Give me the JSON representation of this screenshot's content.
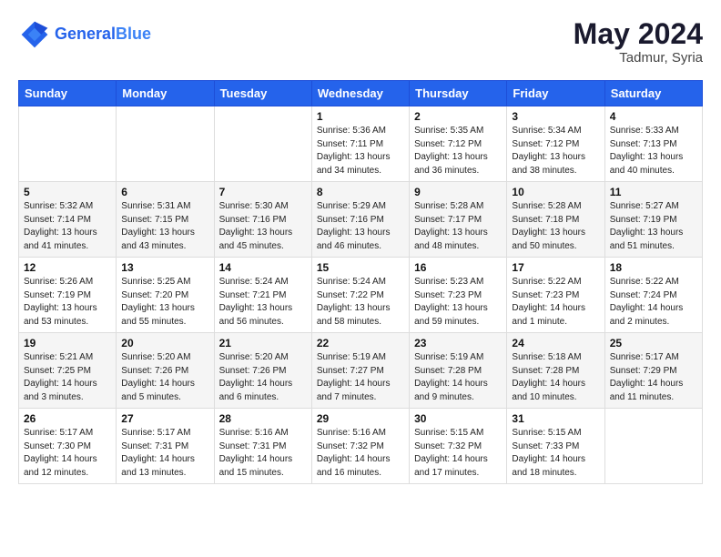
{
  "header": {
    "logo_line1": "General",
    "logo_line2": "Blue",
    "month_year": "May 2024",
    "location": "Tadmur, Syria"
  },
  "weekdays": [
    "Sunday",
    "Monday",
    "Tuesday",
    "Wednesday",
    "Thursday",
    "Friday",
    "Saturday"
  ],
  "weeks": [
    [
      {
        "day": "",
        "info": ""
      },
      {
        "day": "",
        "info": ""
      },
      {
        "day": "",
        "info": ""
      },
      {
        "day": "1",
        "info": "Sunrise: 5:36 AM\nSunset: 7:11 PM\nDaylight: 13 hours\nand 34 minutes."
      },
      {
        "day": "2",
        "info": "Sunrise: 5:35 AM\nSunset: 7:12 PM\nDaylight: 13 hours\nand 36 minutes."
      },
      {
        "day": "3",
        "info": "Sunrise: 5:34 AM\nSunset: 7:12 PM\nDaylight: 13 hours\nand 38 minutes."
      },
      {
        "day": "4",
        "info": "Sunrise: 5:33 AM\nSunset: 7:13 PM\nDaylight: 13 hours\nand 40 minutes."
      }
    ],
    [
      {
        "day": "5",
        "info": "Sunrise: 5:32 AM\nSunset: 7:14 PM\nDaylight: 13 hours\nand 41 minutes."
      },
      {
        "day": "6",
        "info": "Sunrise: 5:31 AM\nSunset: 7:15 PM\nDaylight: 13 hours\nand 43 minutes."
      },
      {
        "day": "7",
        "info": "Sunrise: 5:30 AM\nSunset: 7:16 PM\nDaylight: 13 hours\nand 45 minutes."
      },
      {
        "day": "8",
        "info": "Sunrise: 5:29 AM\nSunset: 7:16 PM\nDaylight: 13 hours\nand 46 minutes."
      },
      {
        "day": "9",
        "info": "Sunrise: 5:28 AM\nSunset: 7:17 PM\nDaylight: 13 hours\nand 48 minutes."
      },
      {
        "day": "10",
        "info": "Sunrise: 5:28 AM\nSunset: 7:18 PM\nDaylight: 13 hours\nand 50 minutes."
      },
      {
        "day": "11",
        "info": "Sunrise: 5:27 AM\nSunset: 7:19 PM\nDaylight: 13 hours\nand 51 minutes."
      }
    ],
    [
      {
        "day": "12",
        "info": "Sunrise: 5:26 AM\nSunset: 7:19 PM\nDaylight: 13 hours\nand 53 minutes."
      },
      {
        "day": "13",
        "info": "Sunrise: 5:25 AM\nSunset: 7:20 PM\nDaylight: 13 hours\nand 55 minutes."
      },
      {
        "day": "14",
        "info": "Sunrise: 5:24 AM\nSunset: 7:21 PM\nDaylight: 13 hours\nand 56 minutes."
      },
      {
        "day": "15",
        "info": "Sunrise: 5:24 AM\nSunset: 7:22 PM\nDaylight: 13 hours\nand 58 minutes."
      },
      {
        "day": "16",
        "info": "Sunrise: 5:23 AM\nSunset: 7:23 PM\nDaylight: 13 hours\nand 59 minutes."
      },
      {
        "day": "17",
        "info": "Sunrise: 5:22 AM\nSunset: 7:23 PM\nDaylight: 14 hours\nand 1 minute."
      },
      {
        "day": "18",
        "info": "Sunrise: 5:22 AM\nSunset: 7:24 PM\nDaylight: 14 hours\nand 2 minutes."
      }
    ],
    [
      {
        "day": "19",
        "info": "Sunrise: 5:21 AM\nSunset: 7:25 PM\nDaylight: 14 hours\nand 3 minutes."
      },
      {
        "day": "20",
        "info": "Sunrise: 5:20 AM\nSunset: 7:26 PM\nDaylight: 14 hours\nand 5 minutes."
      },
      {
        "day": "21",
        "info": "Sunrise: 5:20 AM\nSunset: 7:26 PM\nDaylight: 14 hours\nand 6 minutes."
      },
      {
        "day": "22",
        "info": "Sunrise: 5:19 AM\nSunset: 7:27 PM\nDaylight: 14 hours\nand 7 minutes."
      },
      {
        "day": "23",
        "info": "Sunrise: 5:19 AM\nSunset: 7:28 PM\nDaylight: 14 hours\nand 9 minutes."
      },
      {
        "day": "24",
        "info": "Sunrise: 5:18 AM\nSunset: 7:28 PM\nDaylight: 14 hours\nand 10 minutes."
      },
      {
        "day": "25",
        "info": "Sunrise: 5:17 AM\nSunset: 7:29 PM\nDaylight: 14 hours\nand 11 minutes."
      }
    ],
    [
      {
        "day": "26",
        "info": "Sunrise: 5:17 AM\nSunset: 7:30 PM\nDaylight: 14 hours\nand 12 minutes."
      },
      {
        "day": "27",
        "info": "Sunrise: 5:17 AM\nSunset: 7:31 PM\nDaylight: 14 hours\nand 13 minutes."
      },
      {
        "day": "28",
        "info": "Sunrise: 5:16 AM\nSunset: 7:31 PM\nDaylight: 14 hours\nand 15 minutes."
      },
      {
        "day": "29",
        "info": "Sunrise: 5:16 AM\nSunset: 7:32 PM\nDaylight: 14 hours\nand 16 minutes."
      },
      {
        "day": "30",
        "info": "Sunrise: 5:15 AM\nSunset: 7:32 PM\nDaylight: 14 hours\nand 17 minutes."
      },
      {
        "day": "31",
        "info": "Sunrise: 5:15 AM\nSunset: 7:33 PM\nDaylight: 14 hours\nand 18 minutes."
      },
      {
        "day": "",
        "info": ""
      }
    ]
  ]
}
